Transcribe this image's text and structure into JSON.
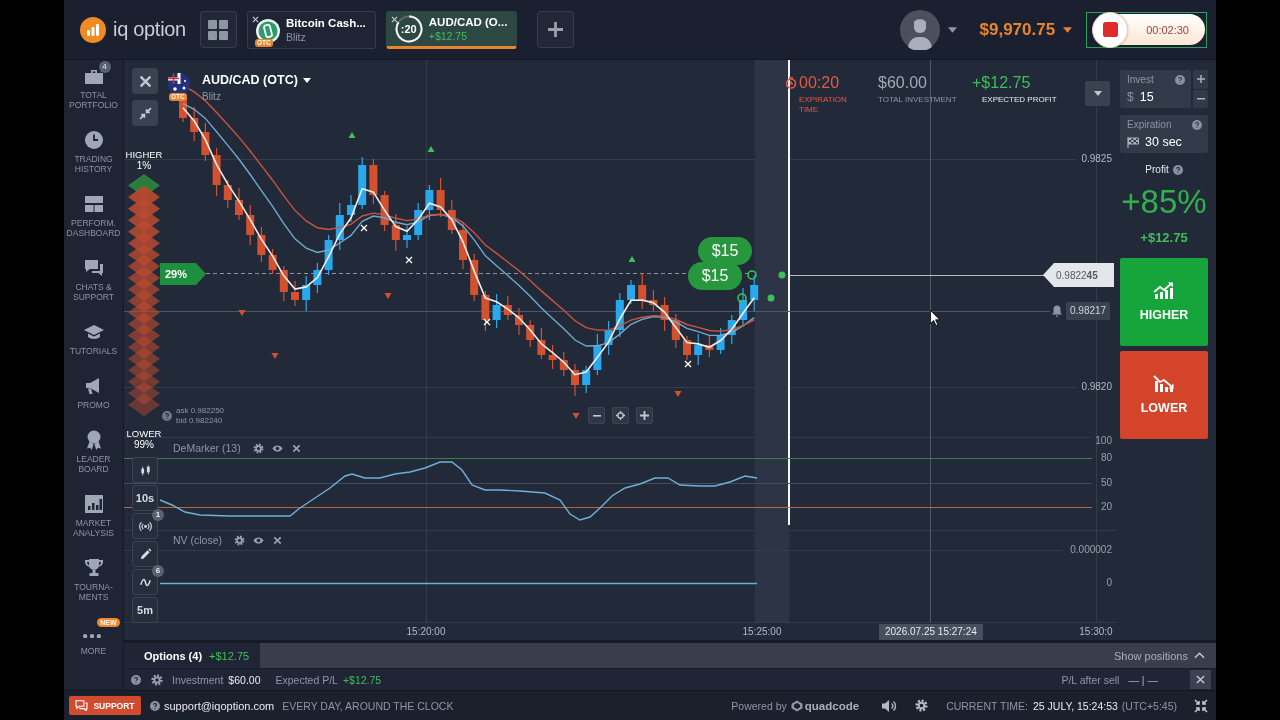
{
  "top_bar": {
    "logo": "iq option",
    "tabs": [
      {
        "title": "Bitcoin Cash...",
        "subtitle": "Blitz",
        "badge": "OTC",
        "kind": "asset",
        "selected": false
      },
      {
        "title": "AUD/CAD (O...",
        "timer": ":20",
        "profit": "+$12.75",
        "kind": "timer",
        "selected": true
      }
    ],
    "balance": "$9,970.75",
    "recorder": {
      "time": "00:02:30"
    }
  },
  "sidebar": {
    "items": [
      {
        "label": "TOTAL PORTFOLIO",
        "badge": {
          "text": "4",
          "kind": "count"
        }
      },
      {
        "label": "TRADING HISTORY"
      },
      {
        "label": "PERFORM. DASHBOARD"
      },
      {
        "label": "CHATS & SUPPORT"
      },
      {
        "label": "TUTORIALS"
      },
      {
        "label": "PROMO"
      },
      {
        "label": "LEADER BOARD"
      },
      {
        "label": "MARKET ANALYSIS"
      },
      {
        "label": "TOURNA-MENTS"
      },
      {
        "label": "MORE",
        "badge": {
          "text": "NEW",
          "kind": "new"
        }
      }
    ]
  },
  "chart": {
    "asset": "AUD/CAD (OTC)",
    "asset_badge": "OTC",
    "mode": "Blitz",
    "expiration": {
      "value": "00:20",
      "label": "EXPIRATION TIME"
    },
    "investment": {
      "value": "$60.00",
      "label": "TOTAL INVESTMENT"
    },
    "expected_profit": {
      "value": "+$12.75",
      "label": "EXPECTED PROFIT"
    },
    "sentiment": {
      "higher_label": "HIGHER",
      "higher_value": "1%",
      "lower_label": "LOWER",
      "lower_value": "99%",
      "marker": "29%"
    },
    "quote": {
      "ask": "ask 0.982250",
      "bid": "bid 0.982240"
    },
    "price_ticks": [
      "0.9825",
      "0.9820"
    ],
    "current_price": "0.9822**45**",
    "alert_price": "0.98217",
    "time_ticks": [
      "15:20:00",
      "15:25:00",
      "15:30:0"
    ],
    "cursor_time": "2026.07.25 15:27:24",
    "trade_bubbles": [
      "$15",
      "$15"
    ],
    "tools": [
      {
        "kind": "icon"
      },
      {
        "kind": "text",
        "label": "10s"
      },
      {
        "kind": "icon",
        "badge": "1"
      },
      {
        "kind": "icon"
      },
      {
        "kind": "icon",
        "badge": "6"
      },
      {
        "kind": "text",
        "label": "5m"
      }
    ],
    "indicators": [
      {
        "name": "DeMarker (13)",
        "levels": [
          "100",
          "80",
          "50",
          "20"
        ]
      },
      {
        "name": "NV (close)",
        "levels": [
          "0.000002",
          "0"
        ]
      }
    ]
  },
  "trade_panel": {
    "invest": {
      "label": "Invest",
      "currency": "$",
      "value": "15"
    },
    "expiration": {
      "label": "Expiration",
      "value": "30 sec"
    },
    "profit": {
      "label": "Profit",
      "percent": "+85%",
      "amount": "+$12.75"
    },
    "actions": [
      {
        "label": "HIGHER",
        "kind": "higher"
      },
      {
        "label": "LOWER",
        "kind": "lower"
      }
    ]
  },
  "positions": {
    "tabs": [
      {
        "label": "Options (4)",
        "value": "+$12.75",
        "selected": true
      }
    ],
    "toggle": "Show positions",
    "investment_label": "Investment",
    "investment": "$60.00",
    "pl_label": "Expected P/L",
    "pl": "+$12.75",
    "after_sell_label": "P/L after sell",
    "after_sell_value": "— | —"
  },
  "footer": {
    "support": "SUPPORT",
    "email": "support@iqoption.com",
    "hours": "EVERY DAY, AROUND THE CLOCK",
    "powered_label": "Powered by",
    "powered_brand": "quadcode",
    "time_label": "CURRENT TIME:",
    "time_value": "25 JULY, 15:24:53",
    "timezone": "(UTC+5:45)"
  }
}
